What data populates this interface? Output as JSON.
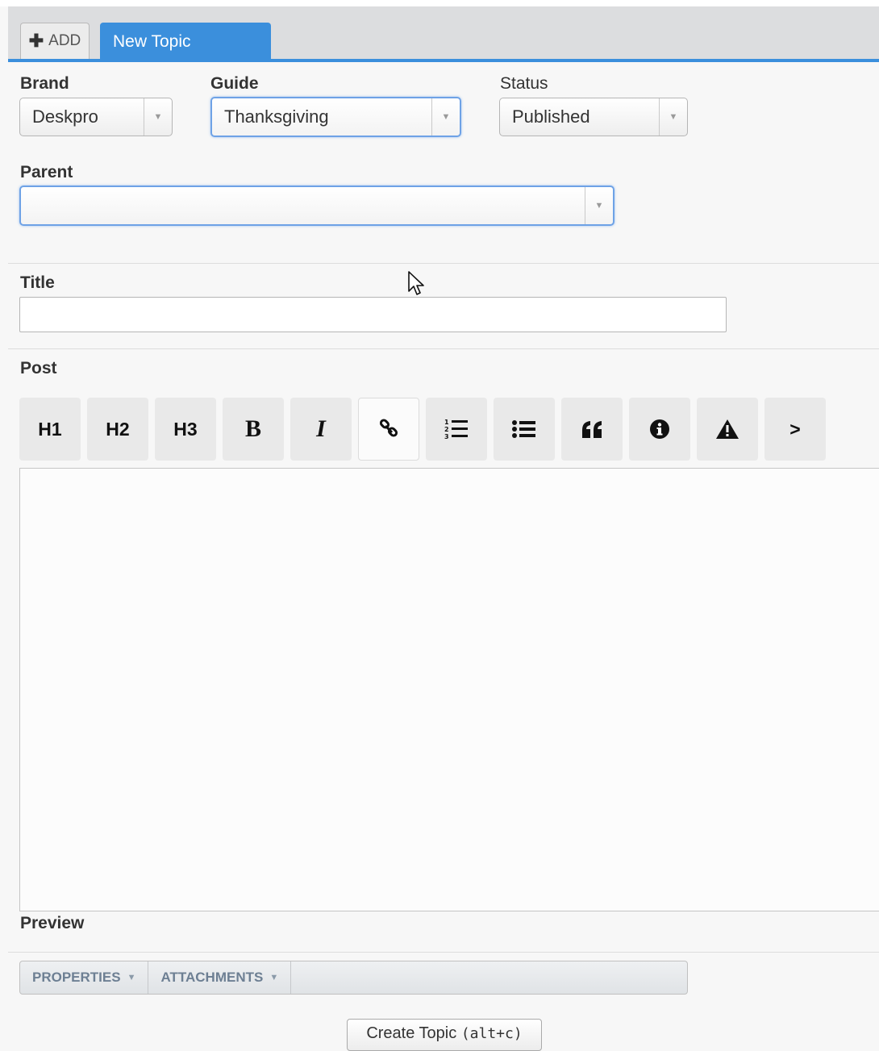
{
  "tabs": {
    "add_label": "ADD",
    "active_tab": "New Topic"
  },
  "form": {
    "brand": {
      "label": "Brand",
      "value": "Deskpro"
    },
    "guide": {
      "label": "Guide",
      "value": "Thanksgiving"
    },
    "status": {
      "label": "Status",
      "value": "Published"
    },
    "parent": {
      "label": "Parent",
      "value": ""
    },
    "title": {
      "label": "Title",
      "value": ""
    },
    "post": {
      "label": "Post"
    },
    "preview": {
      "label": "Preview"
    }
  },
  "toolbar": {
    "h1": "H1",
    "h2": "H2",
    "h3": "H3",
    "bold": "B",
    "italic": "I",
    "more": ">"
  },
  "icons": {
    "add": "plus-icon",
    "link": "link-icon",
    "ordered_list": "ordered-list-icon",
    "unordered_list": "unordered-list-icon",
    "quote": "quote-icon",
    "info": "info-icon",
    "warning": "warning-icon",
    "dropdown": "chevron-down-icon",
    "cursor": "mouse-pointer-icon"
  },
  "bottom_bar": {
    "properties": "PROPERTIES",
    "attachments": "ATTACHMENTS"
  },
  "create_button": {
    "label": "Create Topic",
    "shortcut": "(alt+c)"
  },
  "colors": {
    "accent": "#3b8fdc",
    "focus_border": "#6ea2e6"
  }
}
